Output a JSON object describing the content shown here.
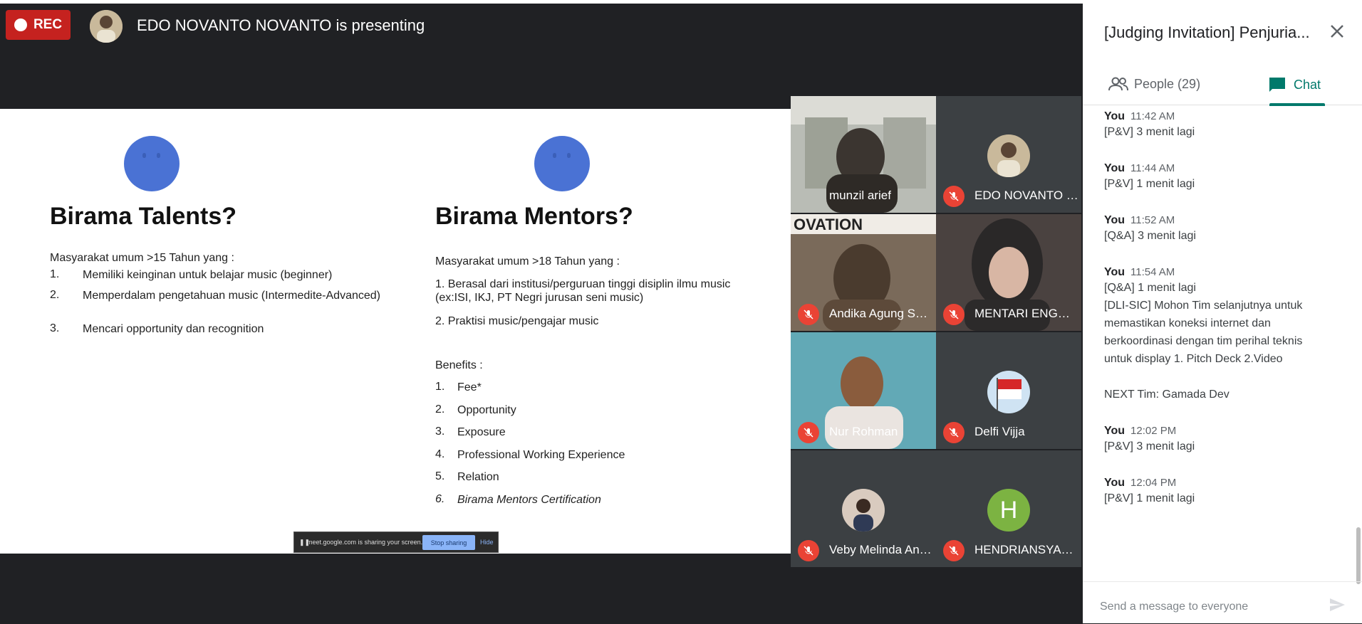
{
  "recording": {
    "label": "REC"
  },
  "presenter": {
    "text": "EDO NOVANTO NOVANTO is presenting"
  },
  "slide": {
    "left_heading": "Birama Talents?",
    "left_intro": "Masyarakat umum >15 Tahun yang :",
    "left_items": [
      {
        "num": "1.",
        "text": "Memiliki keinginan untuk belajar music (beginner)"
      },
      {
        "num": "2.",
        "text": "Memperdalam pengetahuan music (Intermedite-Advanced)"
      },
      {
        "num": "3.",
        "text": "Mencari opportunity dan recognition"
      }
    ],
    "right_heading": "Birama Mentors?",
    "right_intro": "Masyarakat umum >18 Tahun yang :",
    "right_item1": "1. Berasal dari institusi/perguruan tinggi disiplin ilmu music (ex:ISI, IKJ, PT Negri jurusan seni music)",
    "right_item2": "2. Praktisi music/pengajar music",
    "benefits_label": "Benefits :",
    "benefits": [
      {
        "num": "1.",
        "text": "Fee*"
      },
      {
        "num": "2.",
        "text": "Opportunity"
      },
      {
        "num": "3.",
        "text": "Exposure"
      },
      {
        "num": "4.",
        "text": "Professional Working Experience"
      },
      {
        "num": "5.",
        "text": "Relation"
      },
      {
        "num": "6.",
        "text": "Birama Mentors Certification"
      }
    ]
  },
  "sharebar": {
    "message": "meet.google.com is sharing your screen.",
    "stop_label": "Stop sharing",
    "hide_label": "Hide"
  },
  "participants": [
    {
      "name": "munzil arief",
      "muted": false
    },
    {
      "name": "EDO NOVANTO N...",
      "muted": true
    },
    {
      "name": "Andika Agung Sut...",
      "muted": true
    },
    {
      "name": "MENTARI ENGGA...",
      "muted": true
    },
    {
      "name": "Nur Rohman",
      "muted": true
    },
    {
      "name": "Delfi Vijja",
      "muted": true
    },
    {
      "name": "Veby Melinda Ann...",
      "muted": true
    },
    {
      "name": "HENDRIANSYAH ...",
      "muted": true,
      "initial": "H"
    }
  ],
  "panel": {
    "title": "[Judging Invitation] Penjuria...",
    "tab_people": "People (29)",
    "tab_chat": "Chat",
    "messages": [
      {
        "who": "You",
        "time": "11:42 AM",
        "lines": [
          "[P&V] 3 menit lagi"
        ]
      },
      {
        "who": "You",
        "time": "11:44 AM",
        "lines": [
          "[P&V] 1 menit lagi"
        ]
      },
      {
        "who": "You",
        "time": "11:52 AM",
        "lines": [
          "[Q&A] 3 menit lagi"
        ]
      },
      {
        "who": "You",
        "time": "11:54 AM",
        "lines": [
          "[Q&A] 1 menit lagi",
          "[DLI-SIC] Mohon Tim selanjutnya untuk",
          "memastikan koneksi internet dan",
          "berkoordinasi dengan tim perihal teknis",
          "untuk display 1. Pitch Deck 2.Video",
          "",
          "NEXT Tim: Gamada Dev"
        ]
      },
      {
        "who": "You",
        "time": "12:02 PM",
        "lines": [
          "[P&V] 3 menit lagi"
        ]
      },
      {
        "who": "You",
        "time": "12:04 PM",
        "lines": [
          "[P&V] 1 menit lagi"
        ]
      }
    ],
    "compose_placeholder": "Send a message to everyone"
  }
}
